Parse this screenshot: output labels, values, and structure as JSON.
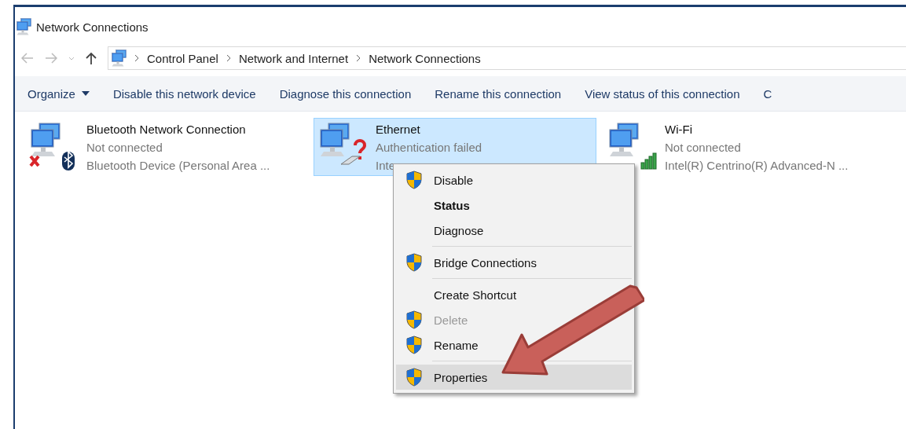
{
  "window": {
    "title": "Network Connections"
  },
  "address_bar": {
    "path": [
      "Control Panel",
      "Network and Internet",
      "Network Connections"
    ]
  },
  "toolbar": {
    "items": [
      {
        "label": "Organize",
        "dropdown": true
      },
      {
        "label": "Disable this network device",
        "dropdown": false
      },
      {
        "label": "Diagnose this connection",
        "dropdown": false
      },
      {
        "label": "Rename this connection",
        "dropdown": false
      },
      {
        "label": "View status of this connection",
        "dropdown": false
      },
      {
        "label": "C",
        "dropdown": false
      }
    ]
  },
  "connections": [
    {
      "kind": "bluetooth",
      "name": "Bluetooth Network Connection",
      "status": "Not connected",
      "device": "Bluetooth Device (Personal Area ...",
      "selected": false
    },
    {
      "kind": "ethernet",
      "name": "Ethernet",
      "status": "Authentication failed",
      "device": "Inte",
      "selected": true
    },
    {
      "kind": "wifi",
      "name": "Wi-Fi",
      "status": "Not connected",
      "device": "Intel(R) Centrino(R) Advanced-N ...",
      "selected": false
    }
  ],
  "context_menu": {
    "items": [
      {
        "kind": "item",
        "label": "Disable",
        "shield": true,
        "bold": false,
        "disabled": false,
        "selected": false
      },
      {
        "kind": "item",
        "label": "Status",
        "shield": false,
        "bold": true,
        "disabled": false,
        "selected": false
      },
      {
        "kind": "item",
        "label": "Diagnose",
        "shield": false,
        "bold": false,
        "disabled": false,
        "selected": false
      },
      {
        "kind": "separator"
      },
      {
        "kind": "item",
        "label": "Bridge Connections",
        "shield": true,
        "bold": false,
        "disabled": false,
        "selected": false
      },
      {
        "kind": "separator"
      },
      {
        "kind": "item",
        "label": "Create Shortcut",
        "shield": false,
        "bold": false,
        "disabled": false,
        "selected": false
      },
      {
        "kind": "item",
        "label": "Delete",
        "shield": true,
        "bold": false,
        "disabled": true,
        "selected": false
      },
      {
        "kind": "item",
        "label": "Rename",
        "shield": true,
        "bold": false,
        "disabled": false,
        "selected": false
      },
      {
        "kind": "separator"
      },
      {
        "kind": "item",
        "label": "Properties",
        "shield": true,
        "bold": false,
        "disabled": false,
        "selected": true
      }
    ]
  }
}
